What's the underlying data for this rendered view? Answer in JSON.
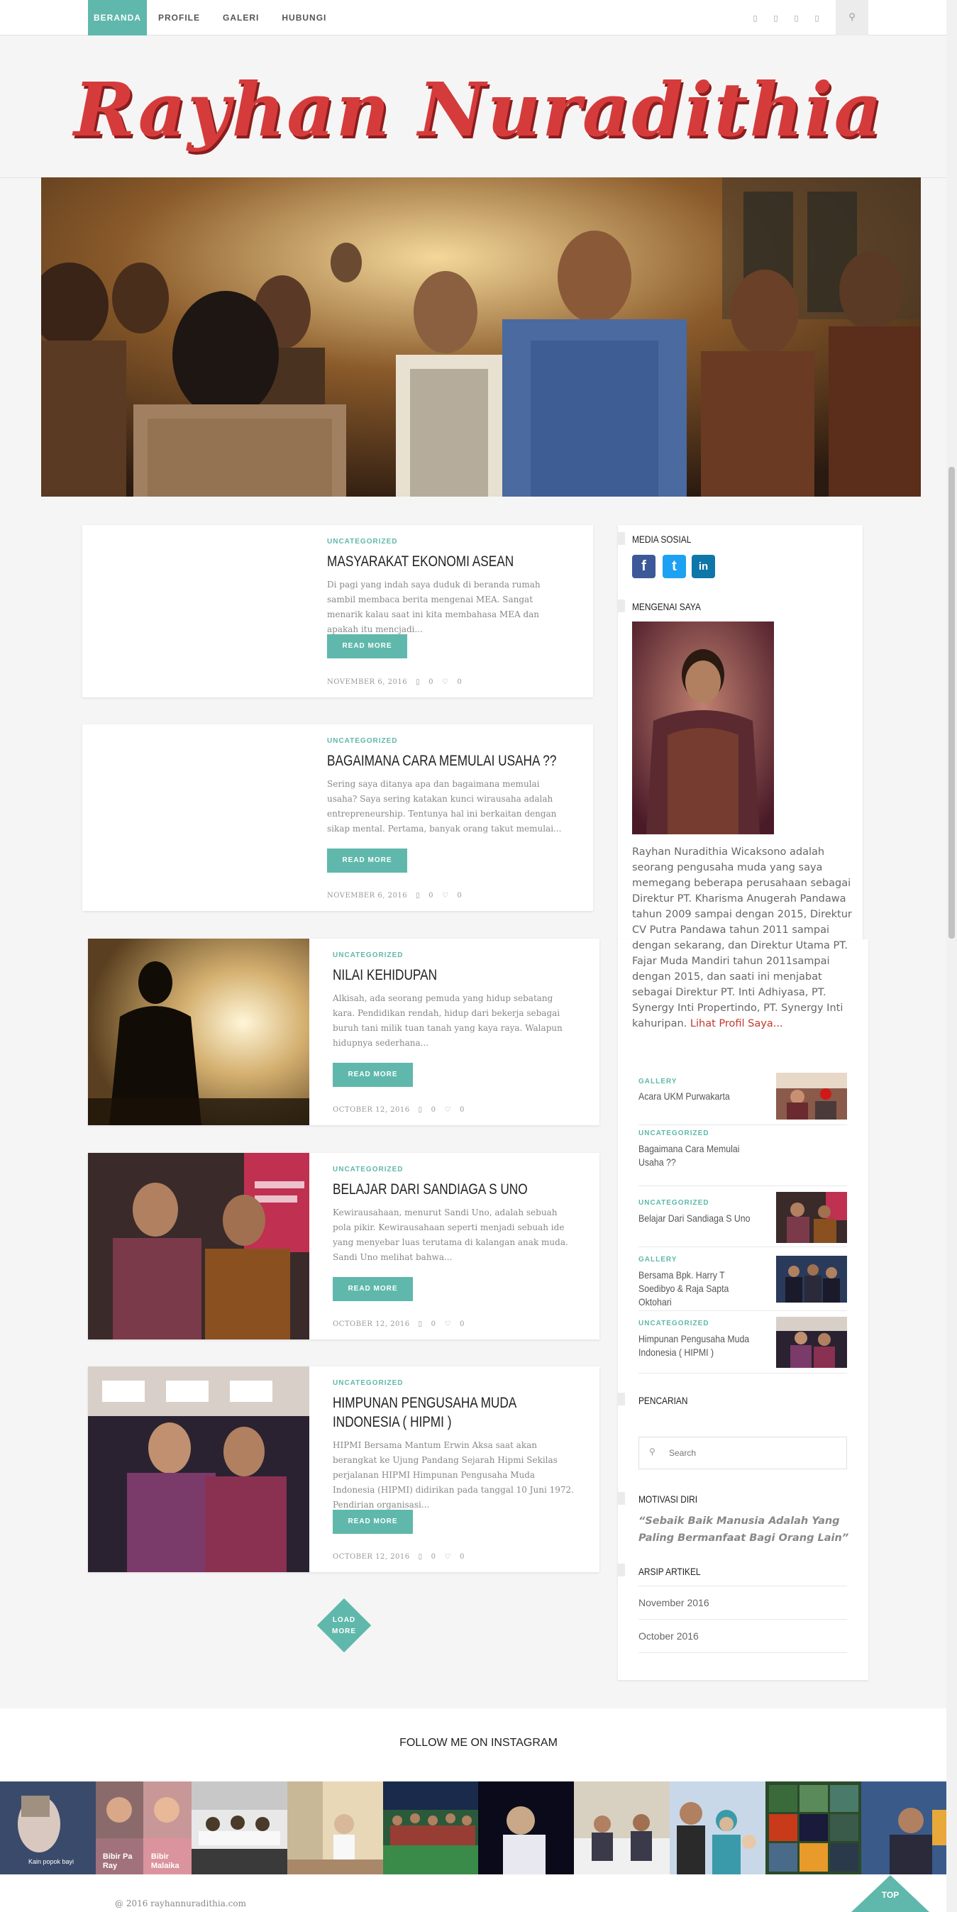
{
  "nav": {
    "items": [
      {
        "label": "BERANDA",
        "active": true
      },
      {
        "label": "PROFILE",
        "active": false
      },
      {
        "label": "GALERI",
        "active": false
      },
      {
        "label": "HUBUNGI",
        "active": false
      }
    ],
    "social_icons": [
      "facebook-icon",
      "twitter-icon",
      "linkedin-icon",
      "instagram-icon"
    ],
    "search_icon": "search-icon"
  },
  "header": {
    "site_title": "Rayhan Nuradithia"
  },
  "posts": [
    {
      "category": "UNCATEGORIZED",
      "title": "MASYARAKAT EKONOMI ASEAN",
      "excerpt": "Di pagi yang indah saya duduk di beranda rumah sambil membaca berita mengenai MEA. Sangat menarik kalau saat ini kita membahasa MEA dan apakah itu mencjadi...",
      "button": "READ MORE",
      "date": "NOVEMBER 6, 2016",
      "comments": "0",
      "likes": "0"
    },
    {
      "category": "UNCATEGORIZED",
      "title": "BAGAIMANA CARA MEMULAI USAHA ??",
      "excerpt": "Sering saya ditanya apa dan bagaimana memulai usaha? Saya sering katakan kunci wirausaha adalah entrepreneurship. Tentunya hal ini berkaitan dengan sikap mental. Pertama, banyak orang takut memulai...",
      "button": "READ MORE",
      "date": "NOVEMBER 6, 2016",
      "comments": "0",
      "likes": "0"
    },
    {
      "category": "UNCATEGORIZED",
      "title": "NILAI KEHIDUPAN",
      "excerpt": "Alkisah, ada seorang pemuda yang hidup sebatang kara. Pendidikan rendah, hidup dari bekerja sebagai buruh tani milik tuan tanah yang kaya raya. Walapun hidupnya sederhana...",
      "button": "READ MORE",
      "date": "OCTOBER 12, 2016",
      "comments": "0",
      "likes": "0"
    },
    {
      "category": "UNCATEGORIZED",
      "title": "BELAJAR DARI SANDIAGA S UNO",
      "excerpt": "Kewirausahaan, menurut Sandi Uno, adalah sebuah pola pikir. Kewirausahaan seperti menjadi sebuah ide yang menyebar luas terutama di kalangan anak muda. Sandi Uno melihat bahwa...",
      "button": "READ MORE",
      "date": "OCTOBER 12, 2016",
      "comments": "0",
      "likes": "0"
    },
    {
      "category": "UNCATEGORIZED",
      "title": "HIMPUNAN PENGUSAHA MUDA INDONESIA ( HIPMI )",
      "excerpt": "HIPMI Bersama Mantum Erwin Aksa saat akan berangkat ke Ujung Pandang Sejarah Hipmi Sekilas perjalanan HIPMI Himpunan Pengusaha Muda Indonesia (HIPMI) didirikan pada tanggal 10 Juni 1972. Pendirian organisasi...",
      "button": "READ MORE",
      "date": "OCTOBER 12, 2016",
      "comments": "0",
      "likes": "0"
    }
  ],
  "load_more": {
    "line1": "LOAD",
    "line2": "MORE"
  },
  "sidebar": {
    "social_title": "MEDIA SOSIAL",
    "social_buttons": [
      {
        "name": "facebook",
        "glyph": "f",
        "color": "#3b5998"
      },
      {
        "name": "twitter",
        "glyph": "t",
        "color": "#1da1f2"
      },
      {
        "name": "linkedin",
        "glyph": "in",
        "color": "#0e76a8"
      }
    ],
    "about_title": "MENGENAI SAYA",
    "about_text": "Rayhan Nuradithia Wicaksono adalah seorang pengusaha  muda yang saya memegang beberapa perusahaan sebagai Direktur PT. Kharisma Anugerah Pandawa tahun 2009 sampai dengan 2015, Direktur CV Putra Pandawa tahun 2011 sampai dengan sekarang,  dan  Direktur Utama PT. Fajar Muda Mandiri tahun 2011sampai dengan 2015, dan saati ini menjabat sebagai Direktur PT. Inti Adhiyasa, PT. Synergy Inti Propertindo, PT. Synergy Inti kahuripan. ",
    "about_link": "Lihat Profil Saya...",
    "recent_posts": [
      {
        "category": "GALLERY",
        "title": "Acara UKM Purwakarta"
      },
      {
        "category": "UNCATEGORIZED",
        "title": "Bagaimana Cara Memulai Usaha ??"
      },
      {
        "category": "UNCATEGORIZED",
        "title": "Belajar Dari Sandiaga S Uno"
      },
      {
        "category": "GALLERY",
        "title": "Bersama Bpk. Harry T Soedibyo & Raja Sapta Oktohari"
      },
      {
        "category": "UNCATEGORIZED",
        "title": "Himpunan Pengusaha Muda Indonesia ( HIPMI )"
      }
    ],
    "search_title": "PENCARIAN",
    "search_placeholder": "Search",
    "motivation_title": "MOTIVASI DIRI",
    "motivation_quote": "“Sebaik Baik Manusia Adalah Yang Paling Bermanfaat Bagi Orang Lain”",
    "archive_title": "ARSIP ARTIKEL",
    "archives": [
      "November 2016",
      "October 2016"
    ]
  },
  "instagram": {
    "title": "FOLLOW ME ON INSTAGRAM",
    "captions": [
      "Kain popok bayi",
      "Bibir Pa Ray",
      "Bibir Malaika"
    ]
  },
  "footer": {
    "copyright": "@ 2016 rayhannuradithia.com",
    "top_label": "TOP"
  }
}
